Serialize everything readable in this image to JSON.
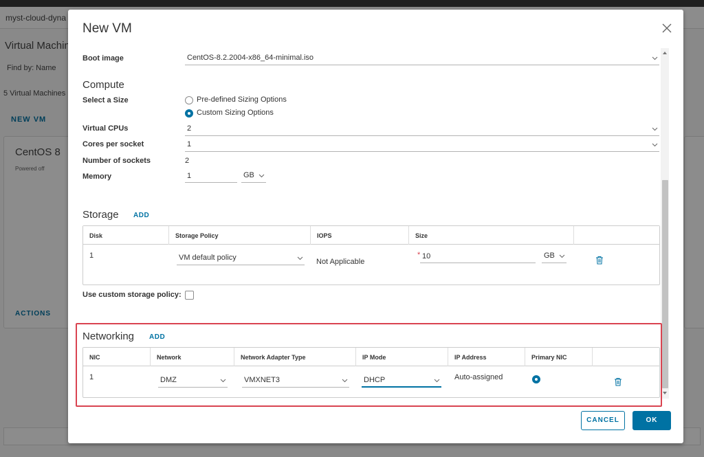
{
  "background": {
    "breadcrumb": "myst-cloud-dyna",
    "page_title": "Virtual Machin",
    "find_by": "Find by:  Name",
    "vm_count": "5 Virtual Machines",
    "new_vm": "NEW VM",
    "card": {
      "title": "CentOS 8",
      "status": "Powered off",
      "actions": "ACTIONS"
    }
  },
  "modal": {
    "title": "New VM",
    "boot_image": {
      "label": "Boot image",
      "value": "CentOS-8.2.2004-x86_64-minimal.iso"
    },
    "compute": {
      "title": "Compute",
      "select_size_label": "Select a Size",
      "size_options": [
        {
          "label": "Pre-defined Sizing Options",
          "selected": false
        },
        {
          "label": "Custom Sizing Options",
          "selected": true
        }
      ],
      "virtual_cpus": {
        "label": "Virtual CPUs",
        "value": "2"
      },
      "cores_per_socket": {
        "label": "Cores per socket",
        "value": "1"
      },
      "num_sockets": {
        "label": "Number of sockets",
        "value": "2"
      },
      "memory": {
        "label": "Memory",
        "value": "1",
        "unit": "GB"
      }
    },
    "storage": {
      "title": "Storage",
      "add": "ADD",
      "columns": [
        "Disk",
        "Storage Policy",
        "IOPS",
        "Size"
      ],
      "rows": [
        {
          "disk": "1",
          "policy": "VM default policy",
          "iops": "Not Applicable",
          "size": "10",
          "unit": "GB"
        }
      ],
      "custom_policy_label": "Use custom storage policy:"
    },
    "networking": {
      "title": "Networking",
      "add": "ADD",
      "columns": [
        "NIC",
        "Network",
        "Network Adapter Type",
        "IP Mode",
        "IP Address",
        "Primary NIC"
      ],
      "rows": [
        {
          "nic": "1",
          "network": "DMZ",
          "adapter": "VMXNET3",
          "ip_mode": "DHCP",
          "ip_address": "Auto-assigned",
          "primary": true
        }
      ]
    },
    "buttons": {
      "cancel": "CANCEL",
      "ok": "OK"
    }
  },
  "colors": {
    "accent": "#0072a3",
    "highlight": "#d94350"
  }
}
